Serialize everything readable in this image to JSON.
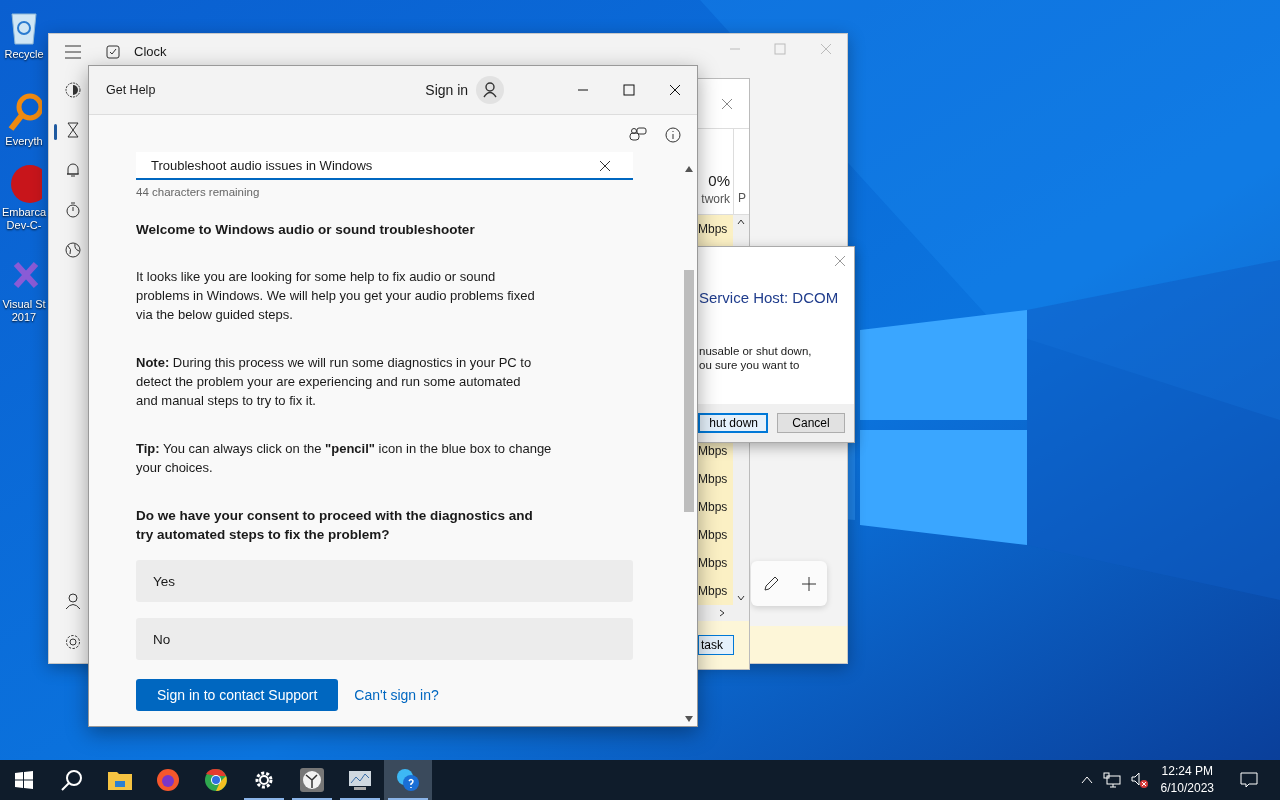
{
  "desktop_icons": [
    {
      "kind": "recycle",
      "lines": [
        "Recycle"
      ]
    },
    {
      "kind": "search",
      "lines": [
        "Everyth"
      ]
    },
    {
      "kind": "devcpp",
      "lines": [
        "Embarca",
        "Dev-C-"
      ]
    },
    {
      "kind": "vs",
      "lines": [
        "Visual St",
        "2017"
      ]
    }
  ],
  "clock_window": {
    "title": "Clock",
    "nav": [
      {
        "kind": "focus",
        "selected": false
      },
      {
        "kind": "timer",
        "selected": true
      },
      {
        "kind": "alarm",
        "selected": false
      },
      {
        "kind": "stopwatch",
        "selected": false
      },
      {
        "kind": "world",
        "selected": false
      }
    ]
  },
  "task_manager": {
    "header_value": "0%",
    "header_label": "twork",
    "column_2": "P",
    "rows_top": [
      "Mbps"
    ],
    "rows_bottom": [
      "Mbps",
      "Mbps",
      "Mbps",
      "Mbps",
      "Mbps",
      "Mbps"
    ],
    "button": "task"
  },
  "dialog": {
    "title": "Service Host: DCOM",
    "lines": [
      "nusable or shut down,",
      "ou sure you want to"
    ],
    "buttons": [
      {
        "label": "hut down",
        "selected": true
      },
      {
        "label": "Cancel",
        "selected": false
      }
    ]
  },
  "get_help": {
    "title": "Get Help",
    "sign_in": "Sign in",
    "search": {
      "value": "Troubleshoot audio issues in Windows"
    },
    "remaining": "44 characters remaining",
    "heading": "Welcome to Windows audio or sound troubleshooter",
    "paragraphs": [
      "It looks like you are looking for some help to fix audio or sound\nproblems in Windows. We will help you get your audio problems fixed\nvia the below guided steps.",
      "**Note:** During this process we will run some diagnostics in your PC to\ndetect the problem your are experiencing and run some automated\n and manual steps to try to fix it.",
      "**Tip:** You can always click on the **\"pencil\"** icon in the blue box to change\nyour choices."
    ],
    "question": "Do we have your consent to proceed with the diagnostics and\ntry automated steps to fix the problem?",
    "options": [
      {
        "label": "Yes"
      },
      {
        "label": "No"
      }
    ],
    "support_button": "Sign in to contact Support",
    "link": "Can't sign in?"
  },
  "taskbar": {
    "apps": [
      {
        "kind": "explorer",
        "running": false,
        "selected": false
      },
      {
        "kind": "firefox",
        "running": false,
        "selected": false
      },
      {
        "kind": "chrome",
        "running": false,
        "selected": false
      },
      {
        "kind": "settings",
        "running": true,
        "selected": false
      },
      {
        "kind": "clock",
        "running": true,
        "selected": false
      },
      {
        "kind": "taskmgr",
        "running": true,
        "selected": false
      },
      {
        "kind": "help",
        "running": true,
        "selected": true
      }
    ],
    "time": "12:24 PM",
    "date": "6/10/2023"
  }
}
